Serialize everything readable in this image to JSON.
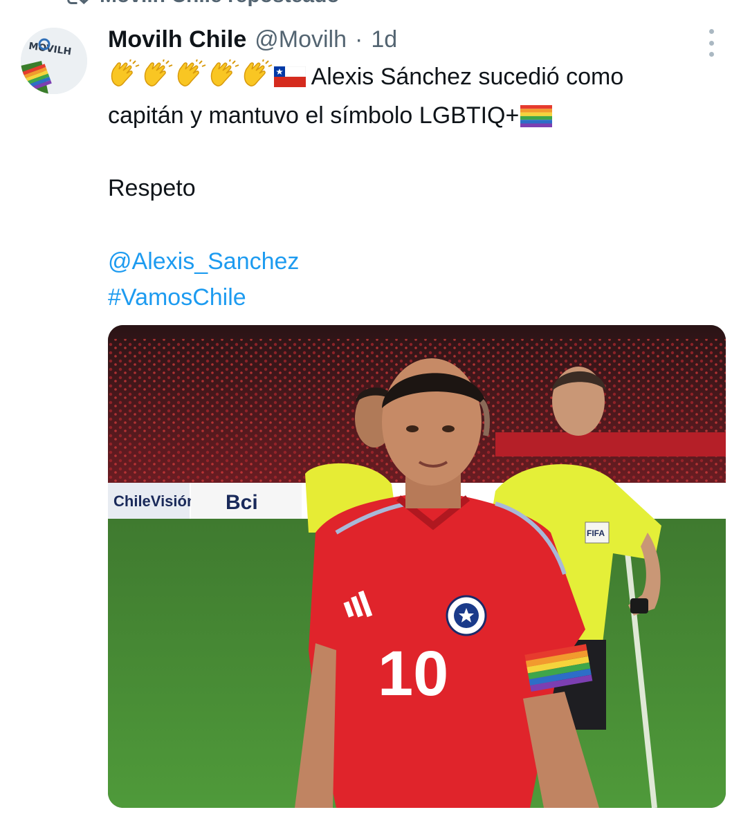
{
  "repost_bar": {
    "text": "Movilh Chile reposteado"
  },
  "tweet": {
    "author_name": "Movilh Chile",
    "handle": "@Movilh",
    "separator": "·",
    "time": "1d",
    "avatar_text": "MOVILH",
    "text_line1": "Alexis Sánchez sucedió como",
    "text_line2": "capitán y mantuvo el símbolo LGBTIQ+",
    "text_line3": "Respeto",
    "mention": "@Alexis_Sanchez",
    "hashtag": "#VamosChile",
    "emojis": [
      "clapping-hands",
      "clapping-hands",
      "clapping-hands",
      "clapping-hands",
      "clapping-hands",
      "chile-flag",
      "rainbow-flag"
    ]
  },
  "media": {
    "jersey_number": "10",
    "ads": [
      "ChileVisión",
      "Bci"
    ],
    "referee_badge": "FIFA"
  },
  "colors": {
    "link": "#1d9bf0",
    "secondary_text": "#536471",
    "jersey_red": "#e0242b",
    "referee_yellow": "#e6f03a"
  }
}
